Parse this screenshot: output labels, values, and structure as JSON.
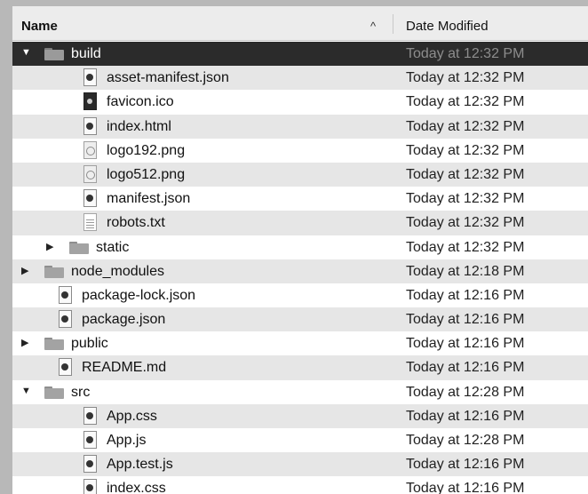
{
  "header": {
    "name_label": "Name",
    "sort_indicator": "^",
    "date_label": "Date Modified"
  },
  "rows": [
    {
      "name": "build",
      "date": "Today at 12:32 PM",
      "kind": "folder",
      "depth": 0,
      "disclosure": "▼",
      "selected": true
    },
    {
      "name": "asset-manifest.json",
      "date": "Today at 12:32 PM",
      "kind": "file",
      "depth": 2,
      "icon": "json-file-icon"
    },
    {
      "name": "favicon.ico",
      "date": "Today at 12:32 PM",
      "kind": "file",
      "depth": 2,
      "icon": "ico-file-icon"
    },
    {
      "name": "index.html",
      "date": "Today at 12:32 PM",
      "kind": "file",
      "depth": 2,
      "icon": "html-file-icon"
    },
    {
      "name": "logo192.png",
      "date": "Today at 12:32 PM",
      "kind": "file",
      "depth": 2,
      "icon": "png-file-icon"
    },
    {
      "name": "logo512.png",
      "date": "Today at 12:32 PM",
      "kind": "file",
      "depth": 2,
      "icon": "png-file-icon"
    },
    {
      "name": "manifest.json",
      "date": "Today at 12:32 PM",
      "kind": "file",
      "depth": 2,
      "icon": "json-file-icon"
    },
    {
      "name": "robots.txt",
      "date": "Today at 12:32 PM",
      "kind": "file",
      "depth": 2,
      "icon": "text-file-icon"
    },
    {
      "name": "static",
      "date": "Today at 12:32 PM",
      "kind": "folder",
      "depth": 1,
      "disclosure": "▶"
    },
    {
      "name": "node_modules",
      "date": "Today at 12:18 PM",
      "kind": "folder",
      "depth": 0,
      "disclosure": "▶"
    },
    {
      "name": "package-lock.json",
      "date": "Today at 12:16 PM",
      "kind": "file",
      "depth": 1,
      "icon": "json-file-icon"
    },
    {
      "name": "package.json",
      "date": "Today at 12:16 PM",
      "kind": "file",
      "depth": 1,
      "icon": "json-file-icon"
    },
    {
      "name": "public",
      "date": "Today at 12:16 PM",
      "kind": "folder",
      "depth": 0,
      "disclosure": "▶"
    },
    {
      "name": "README.md",
      "date": "Today at 12:16 PM",
      "kind": "file",
      "depth": 1,
      "icon": "markdown-file-icon"
    },
    {
      "name": "src",
      "date": "Today at 12:28 PM",
      "kind": "folder",
      "depth": 0,
      "disclosure": "▼"
    },
    {
      "name": "App.css",
      "date": "Today at 12:16 PM",
      "kind": "file",
      "depth": 2,
      "icon": "css-file-icon"
    },
    {
      "name": "App.js",
      "date": "Today at 12:28 PM",
      "kind": "file",
      "depth": 2,
      "icon": "js-file-icon"
    },
    {
      "name": "App.test.js",
      "date": "Today at 12:16 PM",
      "kind": "file",
      "depth": 2,
      "icon": "js-file-icon"
    },
    {
      "name": "index.css",
      "date": "Today at 12:16 PM",
      "kind": "file",
      "depth": 2,
      "icon": "css-file-icon"
    }
  ]
}
